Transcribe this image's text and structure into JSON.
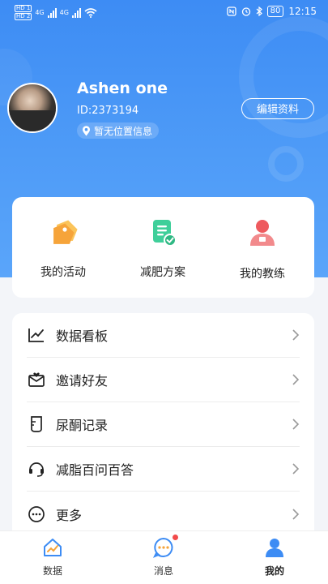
{
  "status_bar": {
    "sim1": "HD 1",
    "sim2": "HD 2",
    "net1": "4G",
    "net2": "4G",
    "battery": "80",
    "time": "12:15"
  },
  "profile": {
    "name": "Ashen one",
    "id": "ID:2373194",
    "location": "暂无位置信息",
    "edit_label": "编辑资料"
  },
  "quick_actions": [
    {
      "label": "我的活动",
      "icon": "tag-icon"
    },
    {
      "label": "减肥方案",
      "icon": "plan-icon"
    },
    {
      "label": "我的教练",
      "icon": "coach-icon"
    }
  ],
  "menu": [
    {
      "label": "数据看板",
      "icon": "chart-board-icon"
    },
    {
      "label": "邀请好友",
      "icon": "invite-envelope-icon"
    },
    {
      "label": "尿酮记录",
      "icon": "test-tube-icon"
    },
    {
      "label": "减脂百问百答",
      "icon": "headset-icon"
    },
    {
      "label": "更多",
      "icon": "more-icon"
    }
  ],
  "tabs": [
    {
      "label": "数据",
      "icon": "home-chart-icon"
    },
    {
      "label": "消息",
      "icon": "message-icon"
    },
    {
      "label": "我的",
      "icon": "user-icon"
    }
  ],
  "colors": {
    "brand_blue": "#3d8cf4",
    "orange": "#f6a43a",
    "green": "#3fcf9a",
    "red": "#ee5a5e"
  }
}
